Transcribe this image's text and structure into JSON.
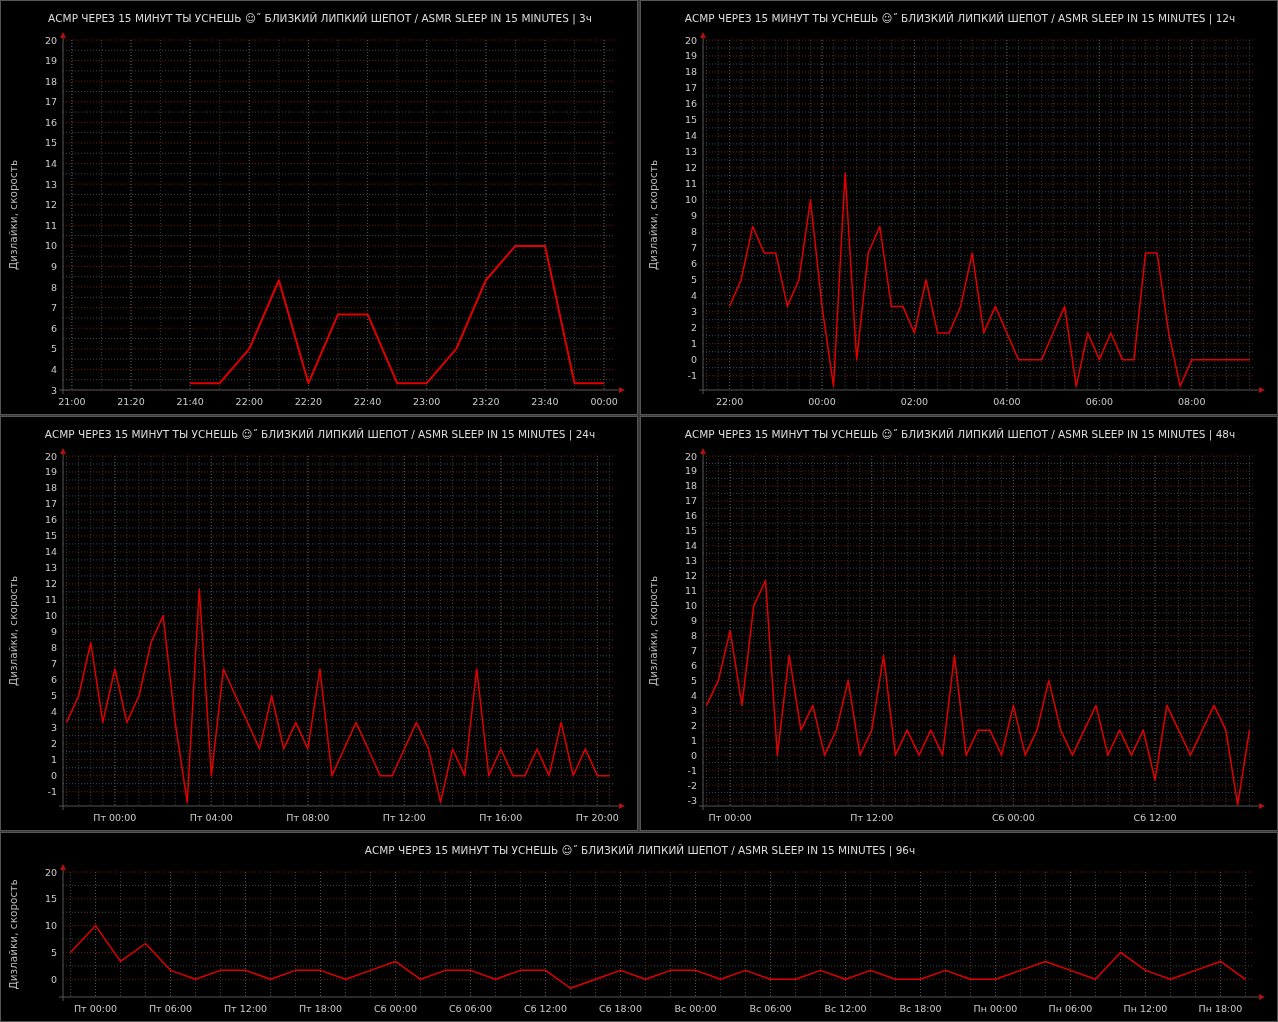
{
  "charts": [
    {
      "chart_data": {
        "type": "line",
        "title": "АСМР ЧЕРЕЗ 15 МИНУТ ТЫ УСНЕШЬ ☺˝ БЛИЗКИЙ ЛИПКИЙ ШЕПОТ / ASMR SLEEP IN 15 MINUTES | 3ч",
        "grid": true,
        "ylabel": "Дизлайки, скорость",
        "ylim": [
          3,
          20
        ],
        "yticks": [
          3,
          4,
          5,
          6,
          7,
          8,
          9,
          10,
          11,
          12,
          13,
          14,
          15,
          16,
          17,
          18,
          19,
          20
        ],
        "categories": [
          "21:00",
          null,
          "21:20",
          null,
          "21:40",
          null,
          "22:00",
          null,
          "22:20",
          null,
          "22:40",
          null,
          "23:00",
          null,
          "23:20",
          null,
          "23:40",
          null,
          "00:00"
        ],
        "series": [
          {
            "color": "#e00000",
            "values": [
              null,
              null,
              null,
              null,
              3.33,
              3.33,
              5,
              8.33,
              3.33,
              6.67,
              6.67,
              3.33,
              3.33,
              5,
              8.33,
              10,
              10,
              3.33,
              3.33
            ]
          }
        ]
      }
    },
    {
      "chart_data": {
        "type": "line",
        "title": "АСМР ЧЕРЕЗ 15 МИНУТ ТЫ УСНЕШЬ ☺˝ БЛИЗКИЙ ЛИПКИЙ ШЕПОТ / ASMR SLEEP IN 15 MINUTES | 12ч",
        "grid": true,
        "ylabel": "Дизлайки, скорость",
        "ylim": [
          -1.9,
          20
        ],
        "yticks": [
          -1,
          0,
          1,
          2,
          3,
          4,
          5,
          6,
          7,
          8,
          9,
          10,
          11,
          12,
          13,
          14,
          15,
          16,
          17,
          18,
          19,
          20
        ],
        "categories": [
          null,
          null,
          "22:00",
          null,
          null,
          null,
          null,
          null,
          null,
          null,
          "00:00",
          null,
          null,
          null,
          null,
          null,
          null,
          null,
          "02:00",
          null,
          null,
          null,
          null,
          null,
          null,
          null,
          "04:00",
          null,
          null,
          null,
          null,
          null,
          null,
          null,
          "06:00",
          null,
          null,
          null,
          null,
          null,
          null,
          null,
          "08:00",
          null,
          null,
          null,
          null,
          null
        ],
        "series": [
          {
            "color": "#e00000",
            "values": [
              null,
              null,
              3.33,
              5,
              8.33,
              6.67,
              6.67,
              3.33,
              5,
              10,
              3.33,
              -1.67,
              11.67,
              0,
              6.67,
              8.33,
              3.33,
              3.33,
              1.67,
              5,
              1.67,
              1.67,
              3.33,
              6.67,
              1.67,
              3.33,
              1.67,
              0,
              0,
              0,
              1.67,
              3.33,
              -1.67,
              1.67,
              0,
              1.67,
              0,
              0,
              6.67,
              6.67,
              1.67,
              -1.67,
              0,
              0,
              0,
              0,
              0,
              0
            ]
          }
        ]
      }
    },
    {
      "chart_data": {
        "type": "line",
        "title": "АСМР ЧЕРЕЗ 15 МИНУТ ТЫ УСНЕШЬ ☺˝ БЛИЗКИЙ ЛИПКИЙ ШЕПОТ / ASMR SLEEP IN 15 MINUTES | 24ч",
        "grid": true,
        "ylabel": "Дизлайки, скорость",
        "ylim": [
          -1.9,
          20
        ],
        "yticks": [
          -1,
          0,
          1,
          2,
          3,
          4,
          5,
          6,
          7,
          8,
          9,
          10,
          11,
          12,
          13,
          14,
          15,
          16,
          17,
          18,
          19,
          20
        ],
        "categories": [
          null,
          null,
          null,
          null,
          "Пт 00:00",
          null,
          null,
          null,
          null,
          null,
          null,
          null,
          "Пт 04:00",
          null,
          null,
          null,
          null,
          null,
          null,
          null,
          "Пт 08:00",
          null,
          null,
          null,
          null,
          null,
          null,
          null,
          "Пт 12:00",
          null,
          null,
          null,
          null,
          null,
          null,
          null,
          "Пт 16:00",
          null,
          null,
          null,
          null,
          null,
          null,
          null,
          "Пт 20:00",
          null
        ],
        "series": [
          {
            "color": "#e00000",
            "values": [
              3.33,
              5,
              8.33,
              3.33,
              6.67,
              3.33,
              5,
              8.33,
              10,
              3.33,
              -1.67,
              11.67,
              0,
              6.67,
              5,
              3.33,
              1.67,
              5,
              1.67,
              3.33,
              1.67,
              6.67,
              0,
              1.67,
              3.33,
              1.67,
              0,
              0,
              1.67,
              3.33,
              1.67,
              -1.67,
              1.67,
              0,
              6.67,
              0,
              1.67,
              0,
              0,
              1.67,
              0,
              3.33,
              0,
              1.67,
              0,
              0
            ]
          }
        ]
      }
    },
    {
      "chart_data": {
        "type": "line",
        "title": "АСМР ЧЕРЕЗ 15 МИНУТ ТЫ УСНЕШЬ ☺˝ БЛИЗКИЙ ЛИПКИЙ ШЕПОТ / ASMR SLEEP IN 15 MINUTES | 48ч",
        "grid": true,
        "ylabel": "Дизлайки, скорость",
        "ylim": [
          -3.4,
          20
        ],
        "yticks": [
          -3,
          -2,
          -1,
          0,
          1,
          2,
          3,
          4,
          5,
          6,
          7,
          8,
          9,
          10,
          11,
          12,
          13,
          14,
          15,
          16,
          17,
          18,
          19,
          20
        ],
        "categories": [
          null,
          null,
          "Пт 00:00",
          null,
          null,
          null,
          null,
          null,
          null,
          null,
          null,
          null,
          null,
          null,
          "Пт 12:00",
          null,
          null,
          null,
          null,
          null,
          null,
          null,
          null,
          null,
          null,
          null,
          "Сб 00:00",
          null,
          null,
          null,
          null,
          null,
          null,
          null,
          null,
          null,
          null,
          null,
          "Сб 12:00",
          null,
          null,
          null,
          null,
          null,
          null,
          null,
          null
        ],
        "series": [
          {
            "color": "#e00000",
            "values": [
              3.33,
              5,
              8.33,
              3.33,
              10,
              11.67,
              0,
              6.67,
              1.67,
              3.33,
              0,
              1.67,
              5,
              0,
              1.67,
              6.67,
              0,
              1.67,
              0,
              1.67,
              0,
              6.67,
              0,
              1.67,
              1.67,
              0,
              3.33,
              0,
              1.67,
              5,
              1.67,
              0,
              1.67,
              3.33,
              0,
              1.67,
              0,
              1.67,
              -1.67,
              3.33,
              1.67,
              0,
              1.67,
              3.33,
              1.67,
              -3.33,
              1.67
            ]
          }
        ]
      }
    },
    {
      "chart_data": {
        "type": "line",
        "title": "АСМР ЧЕРЕЗ 15 МИНУТ ТЫ УСНЕШЬ ☺˝ БЛИЗКИЙ ЛИПКИЙ ШЕПОТ / ASMR SLEEP IN 15 MINUTES | 96ч",
        "grid": true,
        "ylabel": "Дизлайки, скорость",
        "ylim": [
          -3.3,
          20
        ],
        "yticks": [
          0,
          5,
          10,
          15,
          20
        ],
        "categories": [
          null,
          "Пт 00:00",
          null,
          null,
          "Пт 06:00",
          null,
          null,
          "Пт 12:00",
          null,
          null,
          "Пт 18:00",
          null,
          null,
          "Сб 00:00",
          null,
          null,
          "Сб 06:00",
          null,
          null,
          "Сб 12:00",
          null,
          null,
          "Сб 18:00",
          null,
          null,
          "Вс 00:00",
          null,
          null,
          "Вс 06:00",
          null,
          null,
          "Вс 12:00",
          null,
          null,
          "Вс 18:00",
          null,
          null,
          "Пн 00:00",
          null,
          null,
          "Пн 06:00",
          null,
          null,
          "Пн 12:00",
          null,
          null,
          "Пн 18:00",
          null
        ],
        "series": [
          {
            "color": "#e00000",
            "values": [
              5,
              10,
              3.33,
              6.67,
              1.67,
              0,
              1.67,
              1.67,
              0,
              1.67,
              1.67,
              0,
              1.67,
              3.33,
              0,
              1.67,
              1.67,
              0,
              1.67,
              1.67,
              -1.67,
              0,
              1.67,
              0,
              1.67,
              1.67,
              0,
              1.67,
              0,
              0,
              1.67,
              0,
              1.67,
              0,
              0,
              1.67,
              0,
              0,
              1.67,
              3.33,
              1.67,
              0,
              5,
              1.67,
              0,
              1.67,
              3.33,
              0
            ]
          }
        ]
      }
    }
  ]
}
